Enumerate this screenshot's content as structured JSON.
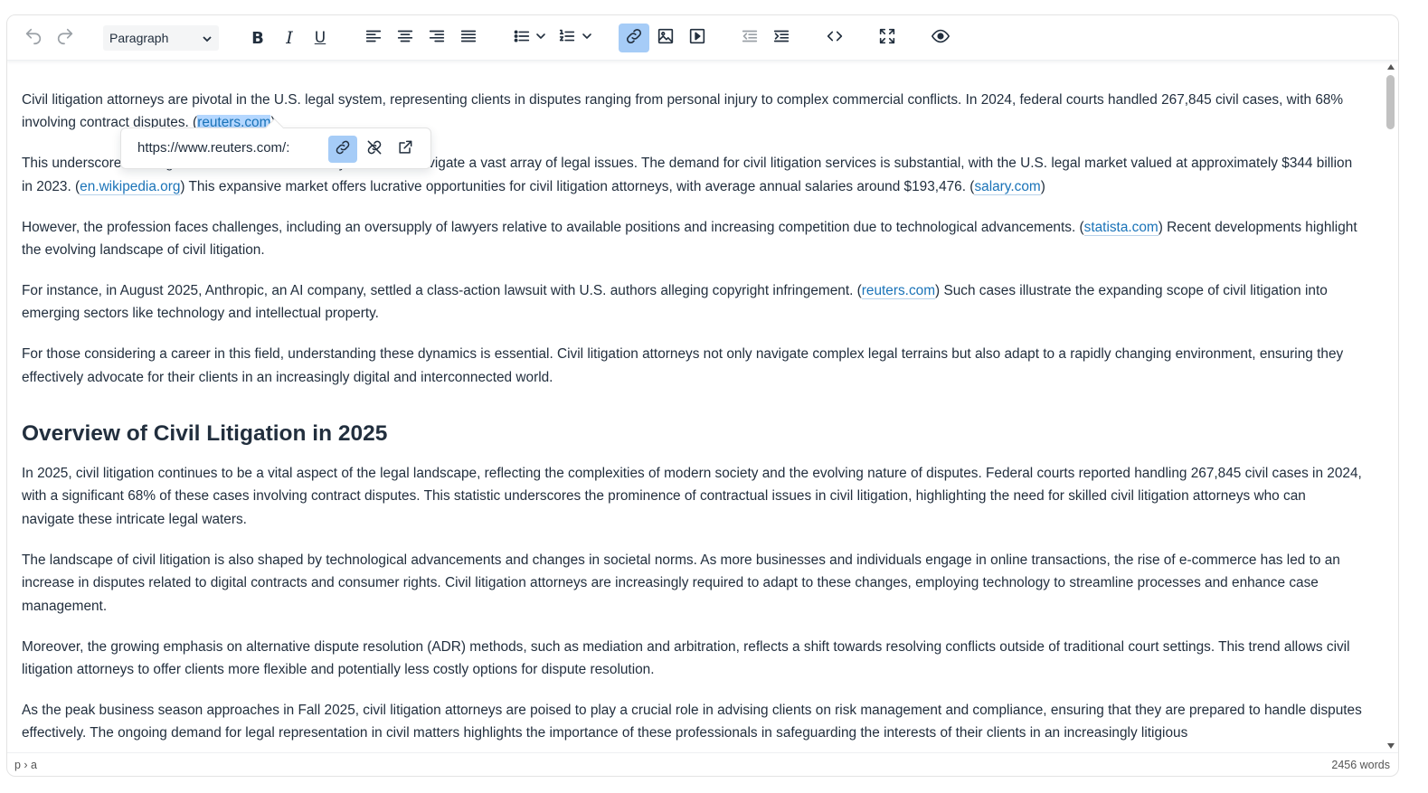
{
  "toolbar": {
    "block_format": "Paragraph",
    "buttons": [
      {
        "name": "undo-icon",
        "state": "disabled"
      },
      {
        "name": "redo-icon",
        "state": "disabled"
      },
      {
        "name": "bold-icon",
        "label": "B"
      },
      {
        "name": "italic-icon",
        "label": "I"
      },
      {
        "name": "underline-icon",
        "label": "U"
      },
      {
        "name": "align-left-icon"
      },
      {
        "name": "align-center-icon"
      },
      {
        "name": "align-right-icon"
      },
      {
        "name": "align-justify-icon"
      },
      {
        "name": "bullet-list-icon"
      },
      {
        "name": "numbered-list-icon"
      },
      {
        "name": "link-icon",
        "state": "active"
      },
      {
        "name": "image-icon"
      },
      {
        "name": "media-icon"
      },
      {
        "name": "outdent-icon"
      },
      {
        "name": "indent-icon"
      },
      {
        "name": "code-icon"
      },
      {
        "name": "fullscreen-icon"
      },
      {
        "name": "preview-icon"
      }
    ]
  },
  "link_popup": {
    "url": "https://www.reuters.com/:"
  },
  "content": {
    "p1": {
      "text": "Civil litigation attorneys are pivotal in the U.S. legal system, representing clients in disputes ranging from personal injury to complex commercial conflicts. In 2024, federal courts handled 267,845 civil cases, with 68% involving contract disputes. (",
      "link": "reuters.com",
      "after": ")"
    },
    "p2": {
      "text": "This underscores the significant demand for attorneys who can navigate a vast array of legal issues. The demand for civil litigation services is substantial, with the U.S. legal market valued at approximately $344 billion in 2023. (",
      "link1": "en.wikipedia.org",
      "mid": ") This expansive market offers lucrative opportunities for civil litigation attorneys, with average annual salaries around $193,476. (",
      "link2": "salary.com",
      "after": ")"
    },
    "p3": {
      "text": "However, the profession faces challenges, including an oversupply of lawyers relative to available positions and increasing competition due to technological advancements. (",
      "link": "statista.com",
      "after": ") Recent developments highlight the evolving landscape of civil litigation."
    },
    "p4": {
      "text": "For instance, in August 2025, Anthropic, an AI company, settled a class-action lawsuit with U.S. authors alleging copyright infringement. (",
      "link": "reuters.com",
      "after": ") Such cases illustrate the expanding scope of civil litigation into emerging sectors like technology and intellectual property."
    },
    "p5": "For those considering a career in this field, understanding these dynamics is essential. Civil litigation attorneys not only navigate complex legal terrains but also adapt to a rapidly changing environment, ensuring they effectively advocate for their clients in an increasingly digital and interconnected world.",
    "h2": "Overview of Civil Litigation in 2025",
    "p6": "In 2025, civil litigation continues to be a vital aspect of the legal landscape, reflecting the complexities of modern society and the evolving nature of disputes. Federal courts reported handling 267,845 civil cases in 2024, with a significant 68% of these cases involving contract disputes. This statistic underscores the prominence of contractual issues in civil litigation, highlighting the need for skilled civil litigation attorneys who can navigate these intricate legal waters.",
    "p7": "The landscape of civil litigation is also shaped by technological advancements and changes in societal norms. As more businesses and individuals engage in online transactions, the rise of e-commerce has led to an increase in disputes related to digital contracts and consumer rights. Civil litigation attorneys are increasingly required to adapt to these changes, employing technology to streamline processes and enhance case management.",
    "p8": "Moreover, the growing emphasis on alternative dispute resolution (ADR) methods, such as mediation and arbitration, reflects a shift towards resolving conflicts outside of traditional court settings. This trend allows civil litigation attorneys to offer clients more flexible and potentially less costly options for dispute resolution.",
    "p9": "As the peak business season approaches in Fall 2025, civil litigation attorneys are poised to play a crucial role in advising clients on risk management and compliance, ensuring that they are prepared to handle disputes effectively. The ongoing demand for legal representation in civil matters highlights the importance of these professionals in safeguarding the interests of their clients in an increasingly litigious"
  },
  "statusbar": {
    "path": "p › a",
    "word_count": "2456 words"
  },
  "colors": {
    "link": "#1a73b8",
    "active_button": "#a6ccf7",
    "text": "#222f3e"
  }
}
